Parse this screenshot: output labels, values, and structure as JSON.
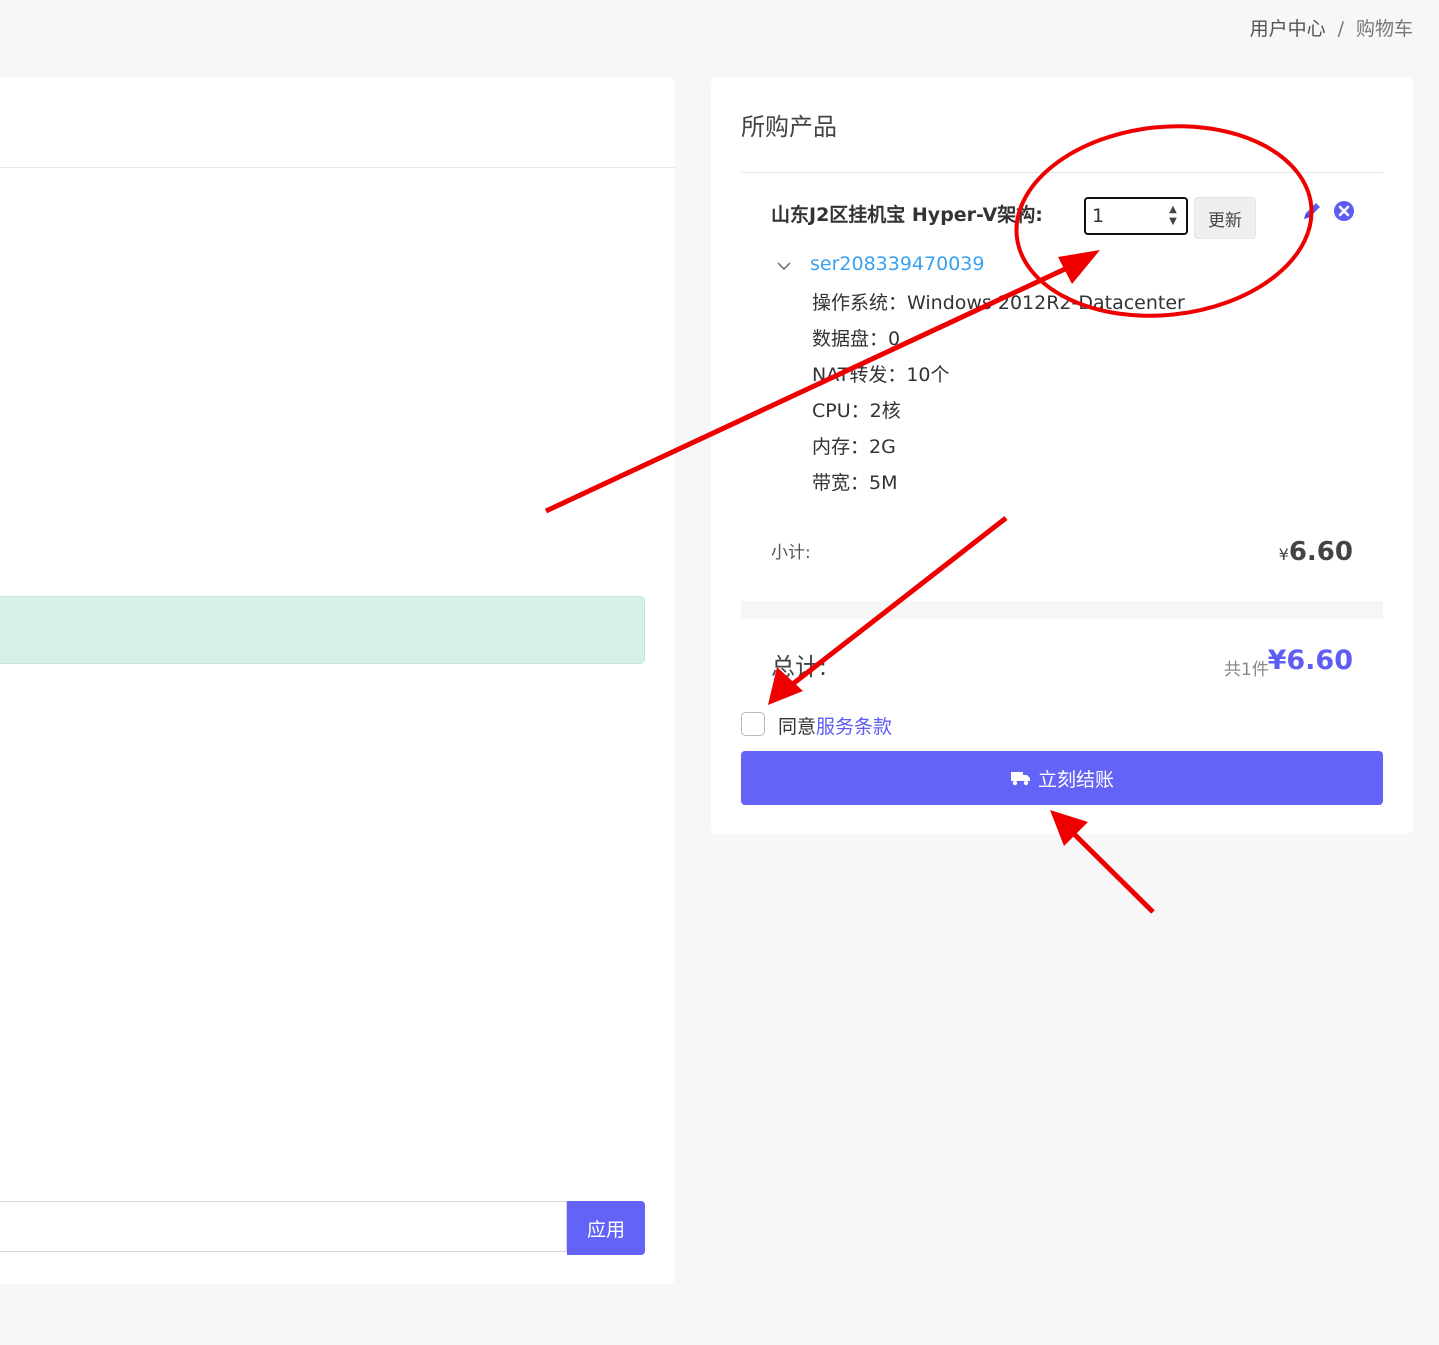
{
  "breadcrumb": {
    "home": "用户中心",
    "separator": "/",
    "current": "购物车"
  },
  "left_panel": {
    "apply_label": "应用"
  },
  "cart": {
    "title": "所购产品",
    "product_name": "山东J2区挂机宝 Hyper-V架构:",
    "quantity": "1",
    "update_label": "更新",
    "service_id": "ser208339470039",
    "specs": [
      "操作系统：Windows 2012R2-Datacenter",
      "数据盘：0",
      "NAT转发：10个",
      "CPU：2核",
      "内存：2G",
      "带宽：5M"
    ],
    "subtotal_label": "小计:",
    "subtotal_currency": "¥",
    "subtotal_amount": "6.60",
    "total_label": "总计:",
    "total_count": "共1件",
    "total_amount": "¥6.60",
    "agree_prefix": "同意",
    "agree_link": "服务条款",
    "checkout_label": "立刻结账"
  },
  "colors": {
    "accent": "#6463f7",
    "link": "#3aa0f0",
    "annotation": "#ee0000"
  },
  "icons": {
    "edit": "pencil-icon",
    "remove": "close-circle-icon",
    "checkout": "truck-icon",
    "toggle": "chevron-down-icon"
  }
}
